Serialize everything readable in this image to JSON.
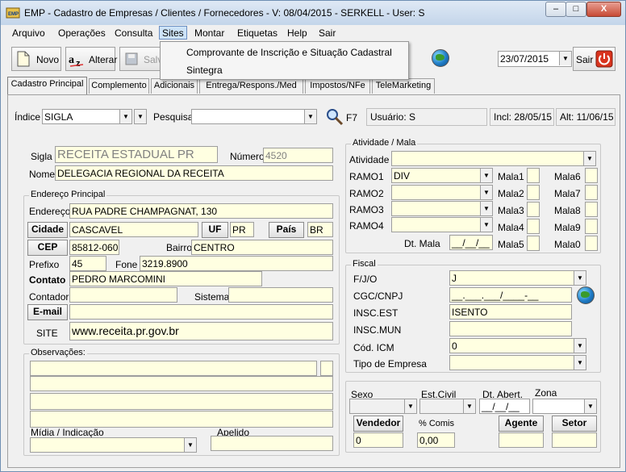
{
  "window": {
    "title": "EMP - Cadastro de Empresas / Clientes / Fornecedores - V: 08/04/2015 - SERKELL - User: S",
    "min": "–",
    "max": "□",
    "close": "X"
  },
  "menu": {
    "items": [
      "Arquivo",
      "Operações",
      "Consulta",
      "Sites",
      "Montar",
      "Etiquetas",
      "Help",
      "Sair"
    ],
    "dropdown": [
      "Comprovante de Inscrição e Situação Cadastral",
      "Sintegra"
    ]
  },
  "toolbar": {
    "novo": "Novo",
    "alterar": "Alterar",
    "salvar": "Salv",
    "date": "23/07/2015",
    "sair": "Sair"
  },
  "tabs": [
    "Cadastro Principal",
    "Complemento",
    "Adicionais",
    "Entrega/Respons./Med",
    "Impostos/NFe",
    "TeleMarketing"
  ],
  "search": {
    "indice_label": "Índice",
    "indice_value": "SIGLA",
    "pesquisa_label": "Pesquisa",
    "f7": "F7",
    "usuario": "Usuário: S",
    "incl": "Incl: 28/05/15",
    "alt": "Alt: 11/06/15"
  },
  "main": {
    "sigla_label": "Sigla",
    "sigla": "RECEITA ESTADUAL PR",
    "numero_label": "Número",
    "numero": "4520",
    "nome_label": "Nome",
    "nome": "DELEGACIA REGIONAL DA RECEITA"
  },
  "endereco": {
    "title": "Endereço Principal",
    "endereco_label": "Endereço",
    "endereco": "RUA PADRE CHAMPAGNAT, 130",
    "cidade_btn": "Cidade",
    "cidade": "CASCAVEL",
    "uf_btn": "UF",
    "uf": "PR",
    "pais_btn": "País",
    "pais": "BR",
    "cep_btn": "CEP",
    "cep": "85812-060",
    "bairro_label": "Bairro",
    "bairro": "CENTRO",
    "prefixo_label": "Prefixo",
    "prefixo": "45",
    "fone_label": "Fone",
    "fone": "3219.8900",
    "contato_label": "Contato",
    "contato": "PEDRO MARCOMINI",
    "contador_label": "Contador",
    "sistema_label": "Sistema",
    "email_btn": "E-mail",
    "site_label": "SITE",
    "site": "www.receita.pr.gov.br"
  },
  "obs": {
    "title": "Observações:",
    "midia_label": "Mídia / Indicação",
    "apelido_label": "Apelido"
  },
  "atividade": {
    "title": "Atividade / Mala",
    "atividade_label": "Atividade",
    "ramos": [
      {
        "label": "RAMO1",
        "value": "DIV"
      },
      {
        "label": "RAMO2",
        "value": ""
      },
      {
        "label": "RAMO3",
        "value": ""
      },
      {
        "label": "RAMO4",
        "value": ""
      }
    ],
    "malas_left": [
      "Mala1",
      "Mala2",
      "Mala3",
      "Mala4",
      "Mala5"
    ],
    "malas_right": [
      "Mala6",
      "Mala7",
      "Mala8",
      "Mala9",
      "Mala0"
    ],
    "dt_mala_label": "Dt. Mala",
    "dt_mala": "__/__/__"
  },
  "fiscal": {
    "title": "Fiscal",
    "fjo_label": "F/J/O",
    "fjo": "J",
    "cgc_label": "CGC/CNPJ",
    "cgc": "__.___.___/____-__",
    "insc_est_label": "INSC.EST",
    "insc_est": "ISENTO",
    "insc_mun_label": "INSC.MUN",
    "cod_icm_label": "Cód. ICM",
    "cod_icm": "0",
    "tipo_label": "Tipo de Empresa"
  },
  "pessoal": {
    "sexo_label": "Sexo",
    "estcivil_label": "Est.Civil",
    "dtabert_label": "Dt. Abert.",
    "dtabert": "__/__/__",
    "zona_label": "Zona",
    "vendedor_btn": "Vendedor",
    "vendedor": "0",
    "comis_label": "% Comis",
    "comis": "0,00",
    "agente_btn": "Agente",
    "setor_btn": "Setor"
  }
}
